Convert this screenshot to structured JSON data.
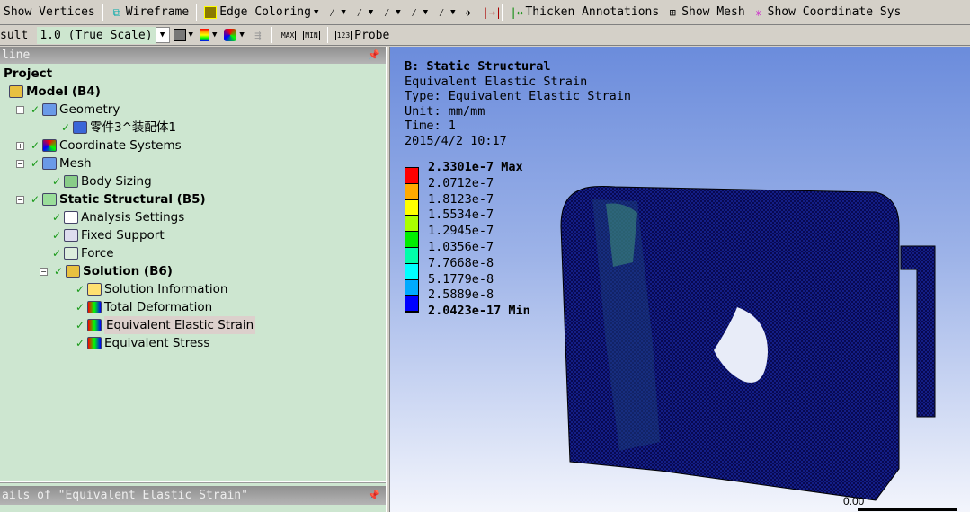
{
  "toolbar1": {
    "show_vertices": "Show Vertices",
    "wireframe": "Wireframe",
    "edge_coloring": "Edge Coloring",
    "thicken": "Thicken Annotations",
    "show_mesh": "Show Mesh",
    "show_coord": "Show Coordinate Sys"
  },
  "toolbar2": {
    "result_label": "sult",
    "scale_value": "1.0 (True Scale)",
    "max": "MAX",
    "min": "MIN",
    "probe": "Probe"
  },
  "outline": {
    "title": "line",
    "items": [
      {
        "label": "Project",
        "bold": true
      },
      {
        "label": "Model (B4)",
        "bold": true
      },
      {
        "label": "Geometry"
      },
      {
        "label": "零件3^装配体1"
      },
      {
        "label": "Coordinate Systems"
      },
      {
        "label": "Mesh"
      },
      {
        "label": "Body Sizing"
      },
      {
        "label": "Static Structural (B5)",
        "bold": true
      },
      {
        "label": "Analysis Settings"
      },
      {
        "label": "Fixed Support"
      },
      {
        "label": "Force"
      },
      {
        "label": "Solution (B6)",
        "bold": true
      },
      {
        "label": "Solution Information"
      },
      {
        "label": "Total Deformation"
      },
      {
        "label": "Equivalent Elastic Strain",
        "selected": true
      },
      {
        "label": "Equivalent Stress"
      }
    ]
  },
  "details": {
    "title": "ails of \"Equivalent Elastic Strain\""
  },
  "viewport": {
    "title": "B: Static Structural",
    "result": "Equivalent Elastic Strain",
    "type": "Type: Equivalent Elastic Strain",
    "unit": "Unit: mm/mm",
    "time": "Time: 1",
    "date": "2015/4/2 10:17",
    "legend": {
      "labels": [
        "2.3301e-7 Max",
        "2.0712e-7",
        "1.8123e-7",
        "1.5534e-7",
        "1.2945e-7",
        "1.0356e-7",
        "7.7668e-8",
        "5.1779e-8",
        "2.5889e-8",
        "2.0423e-17 Min"
      ],
      "colors": [
        "#ff0000",
        "#ffaa00",
        "#ffff00",
        "#aaff00",
        "#00ee00",
        "#00ffaa",
        "#00ffff",
        "#00aaff",
        "#0000ff"
      ]
    },
    "scale_label": "0.00"
  }
}
